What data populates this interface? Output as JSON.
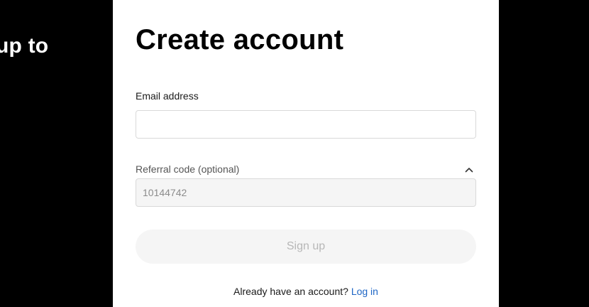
{
  "promo": {
    "partial_text": "up to"
  },
  "form": {
    "title": "Create account",
    "email": {
      "label": "Email address",
      "value": "",
      "placeholder": ""
    },
    "referral": {
      "label": "Referral code (optional)",
      "value": "10144742",
      "expanded": true,
      "toggle_icon": "chevron-up-icon"
    },
    "signup_button": {
      "label": "Sign up",
      "enabled": false
    },
    "login_prompt": {
      "text": "Already have an account?",
      "link_label": "Log in",
      "link_color": "#1e66c5"
    }
  },
  "colors": {
    "background": "#000000",
    "panel": "#ffffff",
    "disabled_button_bg": "#f5f5f5",
    "disabled_button_text": "#b7b7b7",
    "link": "#1e66c5"
  }
}
